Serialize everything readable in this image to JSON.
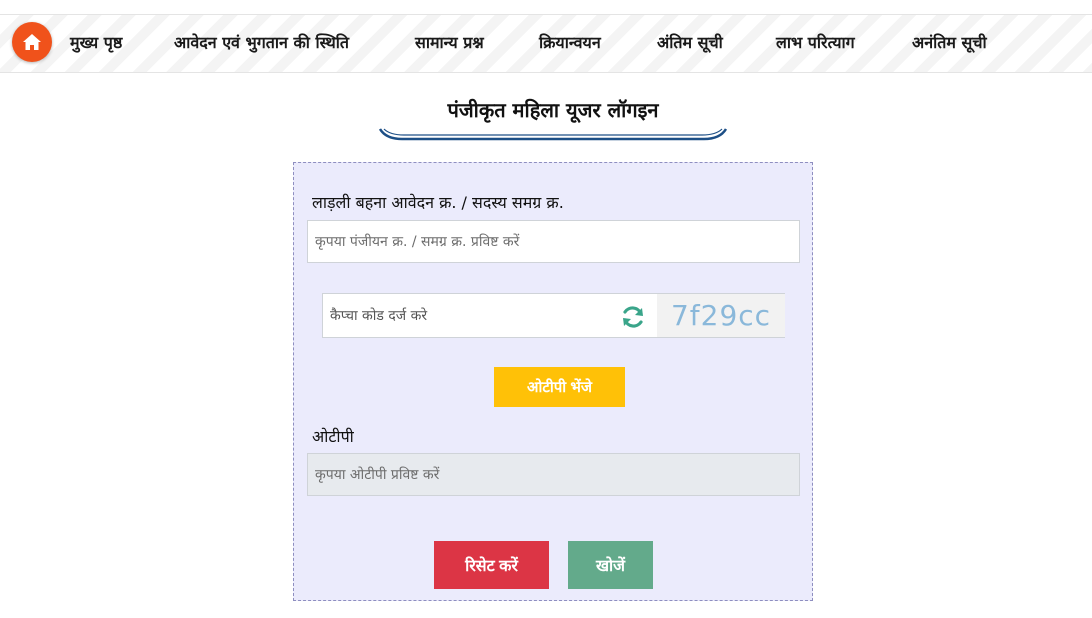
{
  "nav": {
    "home_icon": "home-icon",
    "items": [
      {
        "label": "मुख्य पृष्ठ"
      },
      {
        "label": "आवेदन एवं भुगतान की स्थिति"
      },
      {
        "label": "सामान्य प्रश्न"
      },
      {
        "label": "क्रियान्वयन"
      },
      {
        "label": "अंतिम सूची"
      },
      {
        "label": "लाभ परित्याग"
      },
      {
        "label": "अनंतिम सूची"
      }
    ]
  },
  "page": {
    "title": "पंजीकृत महिला यूजर लॉगइन"
  },
  "form": {
    "applicant_label": "लाड़ली बहना आवेदन क्र. / सदस्य समग्र क्र.",
    "applicant_placeholder": "कृपया पंजीयन क्र. / समग्र क्र. प्रविष्ट करें",
    "applicant_value": "",
    "captcha_placeholder": "कैप्चा कोड दर्ज करे",
    "captcha_value": "",
    "captcha_code": "7f29cc",
    "refresh_icon": "refresh-icon",
    "send_otp_label": "ओटीपी भेंजे",
    "otp_label": "ओटीपी",
    "otp_placeholder": "कृपया ओटीपी प्रविष्ट करें",
    "otp_value": "",
    "reset_label": "रिसेट करें",
    "search_label": "खोजें"
  },
  "colors": {
    "home_button": "#f0521b",
    "panel_bg": "#ebebfc",
    "otp_button": "#ffc107",
    "reset_button": "#dc3545",
    "search_button": "#63aa8b",
    "title_underline": "#1d4f86",
    "captcha_text": "#8ab8da",
    "refresh_icon": "#3aa58a"
  }
}
